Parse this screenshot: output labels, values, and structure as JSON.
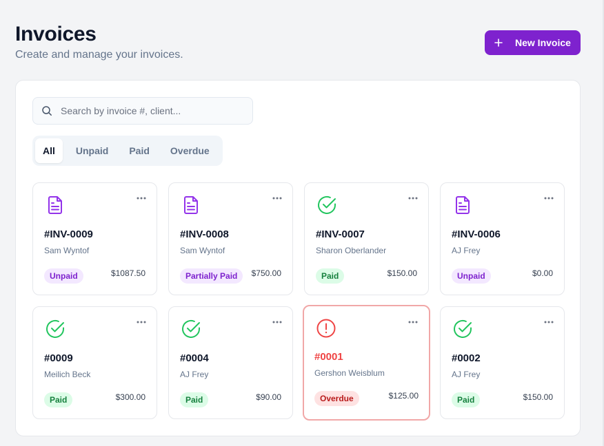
{
  "header": {
    "title": "Invoices",
    "subtitle": "Create and manage your invoices.",
    "new_button_label": "New Invoice"
  },
  "search": {
    "placeholder": "Search by invoice #, client...",
    "value": ""
  },
  "tabs": [
    {
      "label": "All",
      "active": true
    },
    {
      "label": "Unpaid",
      "active": false
    },
    {
      "label": "Paid",
      "active": false
    },
    {
      "label": "Overdue",
      "active": false
    }
  ],
  "invoices": [
    {
      "number": "#INV-0009",
      "client": "Sam Wyntof",
      "status": "Unpaid",
      "amount": "$1087.50",
      "icon": "document-icon"
    },
    {
      "number": "#INV-0008",
      "client": "Sam Wyntof",
      "status": "Partially Paid",
      "amount": "$750.00",
      "icon": "document-icon"
    },
    {
      "number": "#INV-0007",
      "client": "Sharon Oberlander",
      "status": "Paid",
      "amount": "$150.00",
      "icon": "check-circle-icon"
    },
    {
      "number": "#INV-0006",
      "client": "AJ Frey",
      "status": "Unpaid",
      "amount": "$0.00",
      "icon": "document-icon"
    },
    {
      "number": "#0009",
      "client": "Meilich Beck",
      "status": "Paid",
      "amount": "$300.00",
      "icon": "check-circle-icon"
    },
    {
      "number": "#0004",
      "client": "AJ Frey",
      "status": "Paid",
      "amount": "$90.00",
      "icon": "check-circle-icon"
    },
    {
      "number": "#0001",
      "client": "Gershon Weisblum",
      "status": "Overdue",
      "amount": "$125.00",
      "icon": "alert-circle-icon"
    },
    {
      "number": "#0002",
      "client": "AJ Frey",
      "status": "Paid",
      "amount": "$150.00",
      "icon": "check-circle-icon"
    }
  ],
  "colors": {
    "brand": "#7e22ce",
    "paid": "#22c55e",
    "overdue": "#ef4444",
    "document": "#9333ea"
  }
}
